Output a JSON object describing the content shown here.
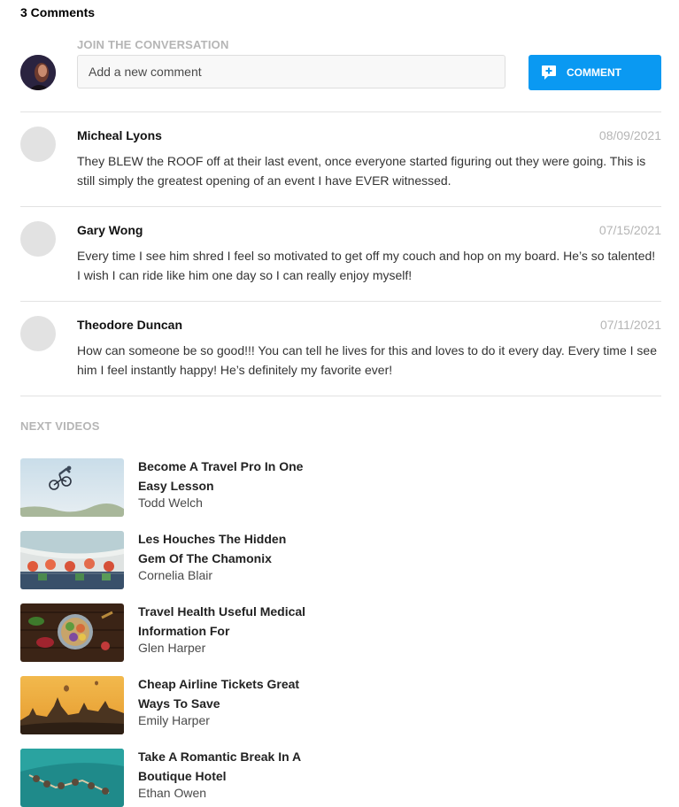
{
  "comments_header": {
    "count_label": "3 Comments"
  },
  "composer": {
    "label": "JOIN THE CONVERSATION",
    "placeholder": "Add a new comment",
    "button_label": "COMMENT",
    "button_icon": "comment-plus-icon",
    "accent_color": "#0a99f2"
  },
  "comments": [
    {
      "author": "Micheal Lyons",
      "date": "08/09/2021",
      "text": "They BLEW the ROOF off at their last event, once everyone started figuring out they were going. This is still simply the greatest opening of an event I have EVER witnessed."
    },
    {
      "author": "Gary Wong",
      "date": "07/15/2021",
      "text": "Every time I see him shred I feel so motivated to get off my couch and hop on my board. He’s so talented! I wish I can ride like him one day so I can really enjoy myself!"
    },
    {
      "author": "Theodore Duncan",
      "date": "07/11/2021",
      "text": "How can someone be so good!!! You can tell he lives for this and loves to do it every day. Every time I see him I feel instantly happy! He’s definitely my favorite ever!"
    }
  ],
  "next_videos": {
    "title": "NEXT VIDEOS",
    "items": [
      {
        "title": "Become A Travel Pro In One Easy Lesson",
        "author": "Todd Welch"
      },
      {
        "title": "Les Houches The Hidden Gem Of The Chamonix",
        "author": "Cornelia Blair"
      },
      {
        "title": "Travel Health Useful Medical Information For",
        "author": "Glen Harper"
      },
      {
        "title": "Cheap Airline Tickets Great Ways To Save",
        "author": "Emily Harper"
      },
      {
        "title": "Take A Romantic Break In A Boutique Hotel",
        "author": "Ethan Owen"
      }
    ]
  }
}
